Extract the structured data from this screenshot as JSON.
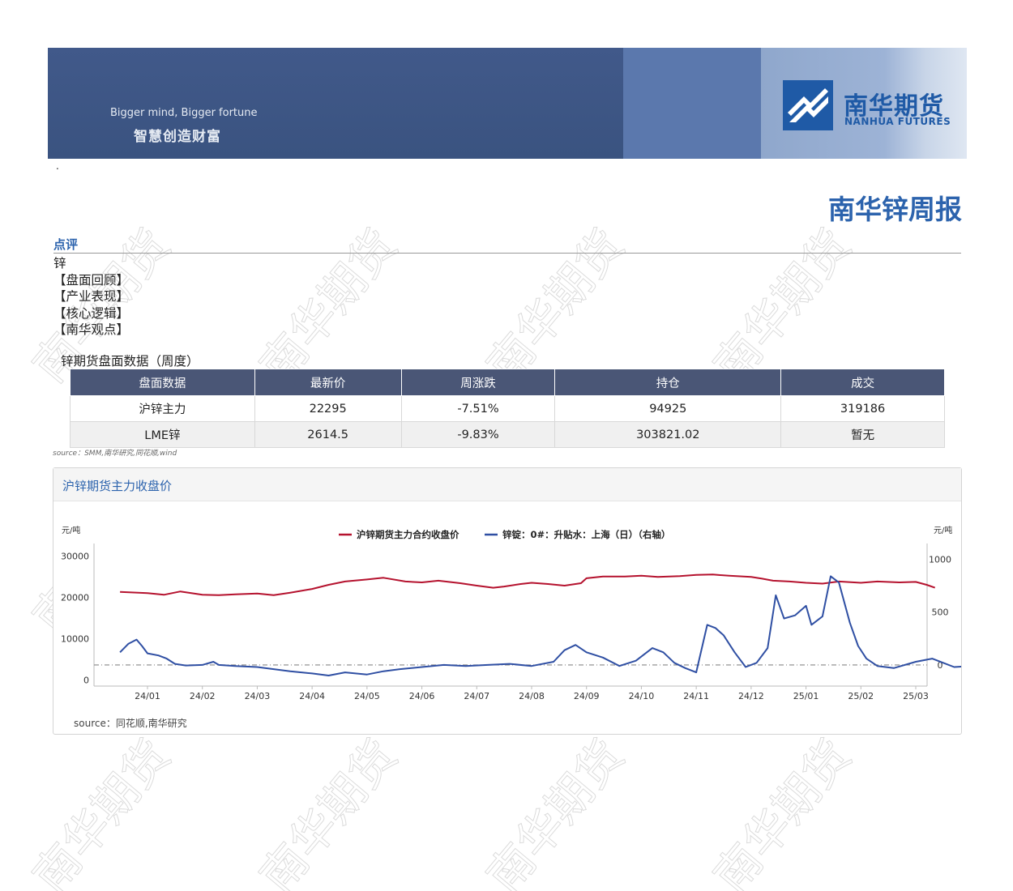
{
  "header": {
    "tagline_en": "Bigger mind, Bigger fortune",
    "tagline_zh": "智慧创造财富",
    "logo_zh": "南华期货",
    "logo_en": "NANHUA FUTURES",
    "marker": "."
  },
  "report_title": "南华锌周报",
  "section": {
    "title": "点评",
    "lines": [
      "锌",
      "【盘面回顾】",
      "【产业表现】",
      "【核心逻辑】",
      "【南华观点】"
    ]
  },
  "table": {
    "title": "锌期货盘面数据（周度）",
    "headers": [
      "盘面数据",
      "最新价",
      "周涨跌",
      "持仓",
      "成交"
    ],
    "rows": [
      [
        "沪锌主力",
        "22295",
        "-7.51%",
        "94925",
        "319186"
      ],
      [
        "LME锌",
        "2614.5",
        "-9.83%",
        "303821.02",
        "暂无"
      ]
    ],
    "source": "source：SMM,南华研究,同花顺,wind"
  },
  "chart": {
    "panel_title": "沪锌期货主力收盘价",
    "source": "source：同花顺,南华研究",
    "watermark": "南华期货",
    "colors": {
      "left_series": "#b5122e",
      "right_series": "#2f4fa3",
      "zero_line": "#888888"
    }
  },
  "chart_data": {
    "type": "line",
    "left_unit": "元/吨",
    "right_unit": "元/吨",
    "left_ticks": [
      30000,
      20000,
      10000,
      0
    ],
    "right_ticks": [
      1000,
      500,
      0
    ],
    "ylim_left": [
      -1500,
      33000
    ],
    "ylim_right": [
      -200,
      1150
    ],
    "x_ticks": [
      "24/01",
      "24/02",
      "24/03",
      "24/04",
      "24/05",
      "24/06",
      "24/07",
      "24/08",
      "24/09",
      "24/10",
      "24/11",
      "24/12",
      "25/01",
      "25/02",
      "25/03"
    ],
    "series": [
      {
        "name": "沪锌期货主力合约收盘价",
        "axis": "left",
        "points": [
          [
            -0.5,
            21300
          ],
          [
            0,
            21000
          ],
          [
            0.3,
            20600
          ],
          [
            0.6,
            21400
          ],
          [
            1,
            20600
          ],
          [
            1.3,
            20500
          ],
          [
            1.6,
            20700
          ],
          [
            2,
            20900
          ],
          [
            2.3,
            20500
          ],
          [
            2.6,
            21100
          ],
          [
            3,
            22000
          ],
          [
            3.3,
            23000
          ],
          [
            3.6,
            23800
          ],
          [
            4,
            24300
          ],
          [
            4.3,
            24700
          ],
          [
            4.7,
            23800
          ],
          [
            5,
            23600
          ],
          [
            5.3,
            24000
          ],
          [
            5.7,
            23400
          ],
          [
            6,
            22800
          ],
          [
            6.3,
            22300
          ],
          [
            6.5,
            22600
          ],
          [
            6.8,
            23200
          ],
          [
            7,
            23500
          ],
          [
            7.3,
            23200
          ],
          [
            7.6,
            22800
          ],
          [
            7.9,
            23400
          ],
          [
            8,
            24600
          ],
          [
            8.3,
            25000
          ],
          [
            8.7,
            25000
          ],
          [
            9,
            25200
          ],
          [
            9.3,
            24900
          ],
          [
            9.7,
            25100
          ],
          [
            10,
            25400
          ],
          [
            10.3,
            25500
          ],
          [
            10.6,
            25200
          ],
          [
            11,
            24900
          ],
          [
            11.2,
            24500
          ],
          [
            11.4,
            24000
          ],
          [
            11.7,
            23800
          ],
          [
            12,
            23500
          ],
          [
            12.3,
            23300
          ],
          [
            12.6,
            23800
          ],
          [
            13,
            23500
          ],
          [
            13.3,
            23800
          ],
          [
            13.7,
            23600
          ],
          [
            14,
            23700
          ],
          [
            14.2,
            23000
          ],
          [
            14.35,
            22300
          ]
        ]
      },
      {
        "name": "锌锭：0#：升贴水：上海（日）（右轴）",
        "axis": "right",
        "points": [
          [
            -0.5,
            120
          ],
          [
            -0.35,
            200
          ],
          [
            -0.2,
            240
          ],
          [
            -0.1,
            180
          ],
          [
            0,
            110
          ],
          [
            0.2,
            90
          ],
          [
            0.35,
            60
          ],
          [
            0.5,
            10
          ],
          [
            0.7,
            -5
          ],
          [
            1,
            0
          ],
          [
            1.2,
            30
          ],
          [
            1.3,
            0
          ],
          [
            1.6,
            -10
          ],
          [
            2,
            -20
          ],
          [
            2.3,
            -40
          ],
          [
            2.6,
            -60
          ],
          [
            3,
            -80
          ],
          [
            3.3,
            -100
          ],
          [
            3.6,
            -70
          ],
          [
            4,
            -90
          ],
          [
            4.3,
            -60
          ],
          [
            4.6,
            -40
          ],
          [
            5,
            -20
          ],
          [
            5.4,
            0
          ],
          [
            5.8,
            -10
          ],
          [
            6.2,
            0
          ],
          [
            6.6,
            10
          ],
          [
            7,
            -10
          ],
          [
            7.4,
            30
          ],
          [
            7.6,
            140
          ],
          [
            7.8,
            190
          ],
          [
            8,
            120
          ],
          [
            8.3,
            70
          ],
          [
            8.6,
            -10
          ],
          [
            8.9,
            40
          ],
          [
            9.2,
            160
          ],
          [
            9.4,
            120
          ],
          [
            9.6,
            20
          ],
          [
            9.8,
            -30
          ],
          [
            10,
            -70
          ],
          [
            10.2,
            380
          ],
          [
            10.35,
            350
          ],
          [
            10.5,
            280
          ],
          [
            10.7,
            120
          ],
          [
            10.9,
            -20
          ],
          [
            11.1,
            20
          ],
          [
            11.3,
            160
          ],
          [
            11.45,
            660
          ],
          [
            11.6,
            440
          ],
          [
            11.8,
            470
          ],
          [
            12,
            560
          ],
          [
            12.1,
            380
          ],
          [
            12.3,
            460
          ],
          [
            12.45,
            840
          ],
          [
            12.6,
            780
          ],
          [
            12.8,
            400
          ],
          [
            12.95,
            180
          ],
          [
            13.1,
            60
          ],
          [
            13.3,
            -10
          ],
          [
            13.6,
            -30
          ],
          [
            14,
            30
          ],
          [
            14.3,
            60
          ],
          [
            14.5,
            20
          ],
          [
            14.7,
            -20
          ],
          [
            15,
            -10
          ],
          [
            15.3,
            0
          ],
          [
            15.6,
            30
          ],
          [
            15.8,
            120
          ],
          [
            15.95,
            180
          ]
        ]
      }
    ]
  }
}
